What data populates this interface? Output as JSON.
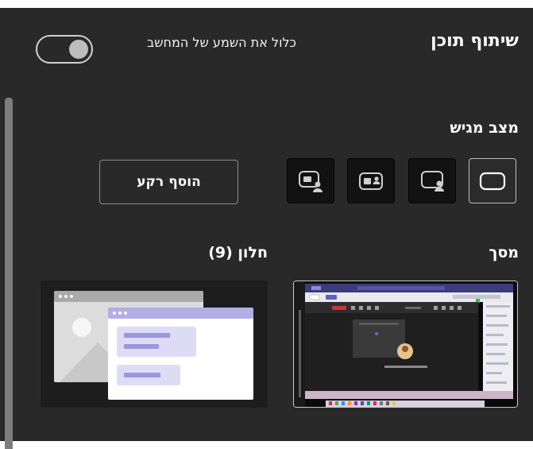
{
  "header": {
    "title": "שיתוף תוכן",
    "include_audio_label": "כלול את השמע של המחשב",
    "include_audio_on": true
  },
  "presenter_mode": {
    "label": "מצב מגיש",
    "modes": [
      "content-only",
      "standout",
      "side-by-side",
      "reporter"
    ],
    "selected": "content-only",
    "add_background_label": "הוסף רקע"
  },
  "sources": {
    "screen_label": "מסך",
    "window_label": "חלון (9)"
  },
  "colors": {
    "panel_bg": "#292929",
    "mode_bg": "#121212",
    "window_accent": "#b4ade6",
    "window_bar": "#5b5fc7"
  },
  "screen_preview": {
    "toolbar_label": "...",
    "tile_text": "...",
    "caption": "..."
  }
}
